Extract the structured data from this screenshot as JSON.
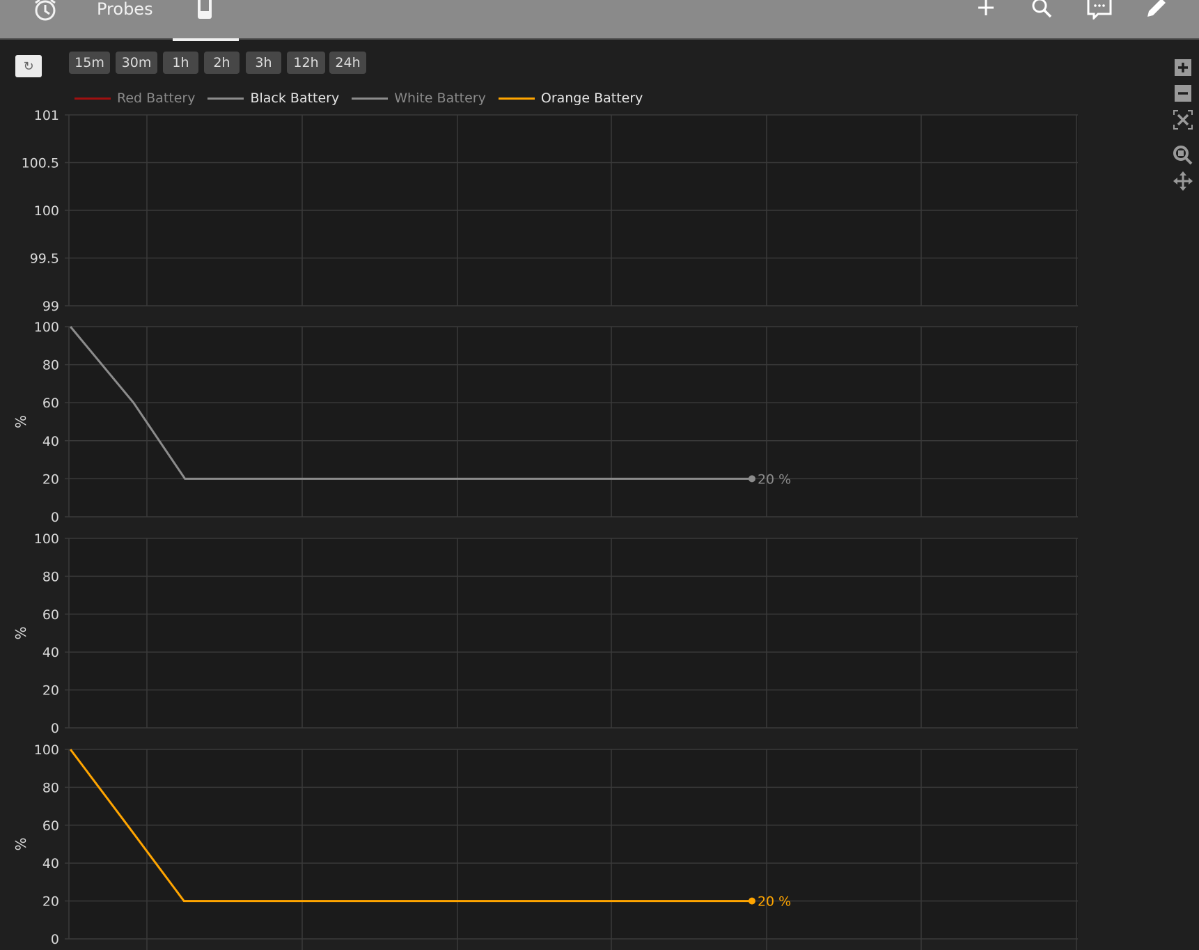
{
  "header": {
    "tab_title": "Probes",
    "icons": [
      "alarm-clock-icon",
      "phone-icon",
      "plus-icon",
      "search-icon",
      "chat-icon",
      "pencil-icon"
    ]
  },
  "toolbar": {
    "refresh_icon": "refresh-icon",
    "ranges": [
      "15m",
      "30m",
      "1h",
      "2h",
      "3h",
      "12h",
      "24h"
    ]
  },
  "modebar": [
    "zoom-in-icon",
    "zoom-out-icon",
    "autoscale-icon",
    "box-zoom-icon",
    "pan-icon"
  ],
  "legend": [
    {
      "label": "Red Battery",
      "color": "#a01010",
      "text_color": "#8a8a8a"
    },
    {
      "label": "Black Battery",
      "color": "#8c8c8c",
      "text_color": "#e6e6e6"
    },
    {
      "label": "White Battery",
      "color": "#8c8c8c",
      "text_color": "#8a8a8a"
    },
    {
      "label": "Orange Battery",
      "color": "#ffa500",
      "text_color": "#e6e6e6"
    }
  ],
  "chart_data": [
    {
      "type": "line",
      "name": "Red Battery",
      "ylabel": "",
      "ylim": [
        99,
        101
      ],
      "yticks": [
        "99",
        "99.5",
        "100",
        "100.5",
        "101"
      ],
      "ytick_values": [
        99,
        99.5,
        100,
        100.5,
        101
      ],
      "xlim": [
        0,
        100
      ],
      "grid": true,
      "color": "#a01010",
      "points": [],
      "end_label": ""
    },
    {
      "type": "line",
      "name": "Black Battery",
      "ylabel": "%",
      "ylim": [
        0,
        100
      ],
      "yticks": [
        "0",
        "20",
        "40",
        "60",
        "80",
        "100"
      ],
      "ytick_values": [
        0,
        20,
        40,
        60,
        80,
        100
      ],
      "xlim": [
        0,
        100
      ],
      "grid": true,
      "color": "#8c8c8c",
      "points": [
        [
          0.15,
          100
        ],
        [
          6.4,
          60
        ],
        [
          11.5,
          20
        ],
        [
          67.7,
          20
        ]
      ],
      "end_label": "20 %"
    },
    {
      "type": "line",
      "name": "White Battery",
      "ylabel": "%",
      "ylim": [
        0,
        100
      ],
      "yticks": [
        "0",
        "20",
        "40",
        "60",
        "80",
        "100"
      ],
      "ytick_values": [
        0,
        20,
        40,
        60,
        80,
        100
      ],
      "xlim": [
        0,
        100
      ],
      "grid": true,
      "color": "#8c8c8c",
      "points": [],
      "end_label": ""
    },
    {
      "type": "line",
      "name": "Orange Battery",
      "ylabel": "%",
      "ylim": [
        0,
        100
      ],
      "yticks": [
        "0",
        "20",
        "40",
        "60",
        "80",
        "100"
      ],
      "ytick_values": [
        0,
        20,
        40,
        60,
        80,
        100
      ],
      "xlim": [
        0,
        100
      ],
      "grid": true,
      "color": "#ffa500",
      "points": [
        [
          0.15,
          100
        ],
        [
          5.8,
          60
        ],
        [
          11.4,
          20
        ],
        [
          67.7,
          20
        ]
      ],
      "end_label": "20 %"
    }
  ]
}
